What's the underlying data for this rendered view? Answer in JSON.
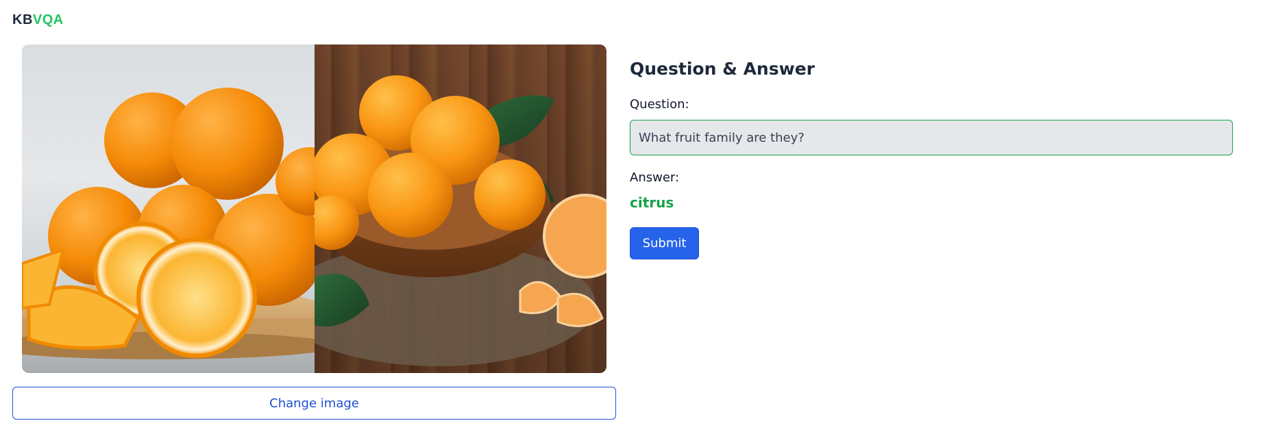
{
  "logo": {
    "part1": "KB",
    "part2": "VQA",
    "accent_color": "#22c55e"
  },
  "image": {
    "description_left": "Oranges on a wooden board with halved slices",
    "description_right": "Mandarins in a wooden bowl on rustic table with leaves"
  },
  "change_image_label": "Change image",
  "qa": {
    "title": "Question & Answer",
    "question_label": "Question:",
    "question_value": "What fruit family are they?",
    "answer_label": "Answer:",
    "answer_value": "citrus",
    "submit_label": "Submit"
  },
  "colors": {
    "primary": "#2563eb",
    "success": "#16a34a",
    "title": "#1e293b"
  }
}
